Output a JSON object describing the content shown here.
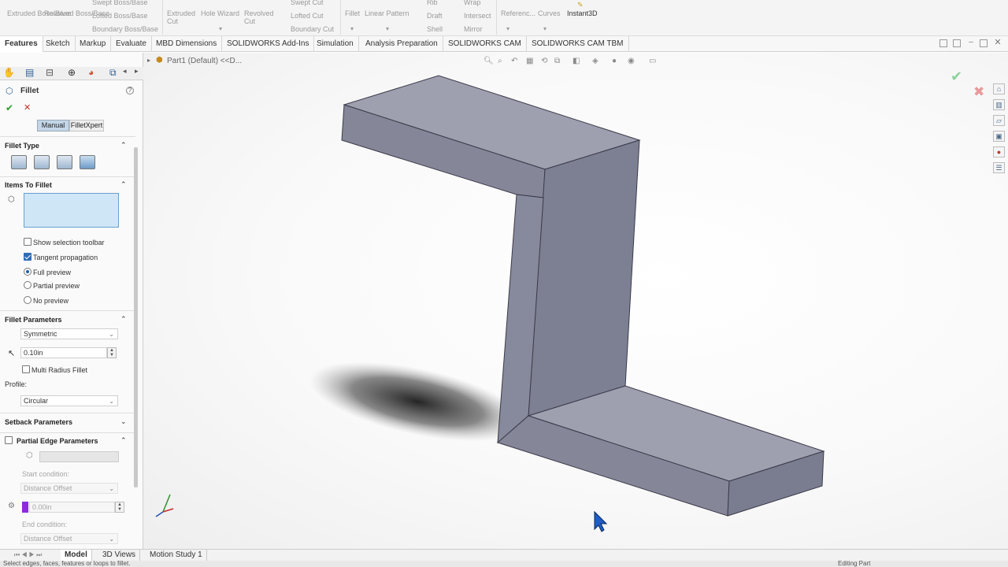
{
  "ribbon": {
    "groups": [
      {
        "label": "Extruded Boss/Base"
      },
      {
        "label": "Revolved Boss/Base"
      },
      {
        "label": "Swept Boss/Base"
      },
      {
        "label": "Lofted Boss/Base"
      },
      {
        "label": "Boundary Boss/Base"
      },
      {
        "label": "Extruded Cut"
      },
      {
        "label": "Hole Wizard"
      },
      {
        "label": "Revolved Cut"
      },
      {
        "label": "Swept Cut"
      },
      {
        "label": "Lofted Cut"
      },
      {
        "label": "Boundary Cut"
      },
      {
        "label": "Fillet"
      },
      {
        "label": "Linear Pattern"
      },
      {
        "label": "Rib"
      },
      {
        "label": "Draft"
      },
      {
        "label": "Shell"
      },
      {
        "label": "Wrap"
      },
      {
        "label": "Intersect"
      },
      {
        "label": "Mirror"
      },
      {
        "label": "Referenc..."
      },
      {
        "label": "Curves"
      },
      {
        "label": "Instant3D"
      }
    ]
  },
  "tabs": [
    "Features",
    "Sketch",
    "Markup",
    "Evaluate",
    "MBD Dimensions",
    "SOLIDWORKS Add-Ins",
    "Simulation",
    "Analysis Preparation",
    "SOLIDWORKS CAM",
    "SOLIDWORKS CAM TBM"
  ],
  "breadcrumb": "Part1 (Default) <<D...",
  "panel": {
    "title": "Fillet",
    "help": "?",
    "modes": [
      "Manual",
      "FilletXpert"
    ],
    "fillet_type": "Fillet Type",
    "items_to_fillet": "Items To Fillet",
    "show_selection_toolbar": "Show selection toolbar",
    "tangent_propagation": "Tangent propagation",
    "full_preview": "Full preview",
    "partial_preview": "Partial preview",
    "no_preview": "No preview",
    "fillet_parameters": "Fillet Parameters",
    "symmetric": "Symmetric",
    "radius": "0.10in",
    "multi_radius": "Multi Radius Fillet",
    "profile_label": "Profile:",
    "profile_value": "Circular",
    "setback": "Setback Parameters",
    "partial_edge": "Partial Edge Parameters",
    "start_condition": "Start condition:",
    "start_value": "Distance Offset",
    "offset_value": "0.00in",
    "end_condition": "End condition:",
    "end_value": "Distance Offset"
  },
  "bottom_tabs": [
    "Model",
    "3D Views",
    "Motion Study 1"
  ],
  "status": {
    "left": "Select edges, faces, features or loops to fillet.",
    "right": "Editing Part"
  },
  "colors": {
    "model_top": "#9ea0b0",
    "model_side": "#858799",
    "model_dark": "#6f7184",
    "accent": "#2e6db5"
  },
  "icons": [
    "zoom-icon",
    "rotate-icon",
    "section-view-icon",
    "display-style-icon",
    "hide-show-icon",
    "view-orientation-icon",
    "ok-check-icon",
    "cancel-x-icon",
    "help-icon",
    "home-icon",
    "folder-icon",
    "appearance-icon",
    "triad-icon",
    "cursor-arrow-icon"
  ]
}
